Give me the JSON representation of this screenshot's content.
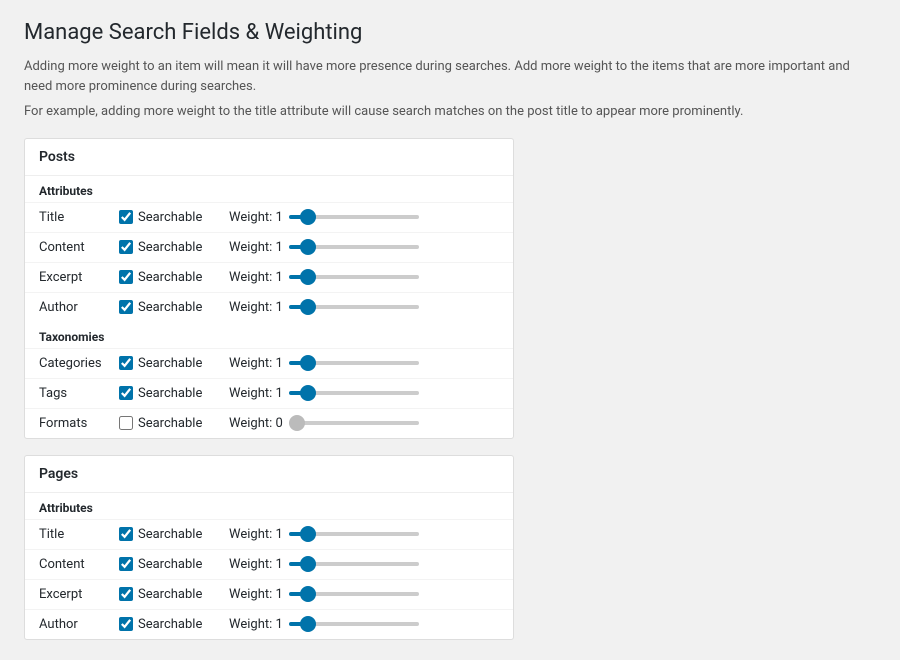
{
  "page": {
    "title": "Manage Search Fields & Weighting",
    "descriptions": [
      "Adding more weight to an item will mean it will have more presence during searches. Add more weight to the items that are more important and need more prominence during searches.",
      "For example, adding more weight to the title attribute will cause search matches on the post title to appear more prominently."
    ]
  },
  "sections": [
    {
      "id": "posts",
      "title": "Posts",
      "groups": [
        {
          "label": "Attributes",
          "fields": [
            {
              "name": "Title",
              "searchable": true,
              "weight": 1
            },
            {
              "name": "Content",
              "searchable": true,
              "weight": 1
            },
            {
              "name": "Excerpt",
              "searchable": true,
              "weight": 1
            },
            {
              "name": "Author",
              "searchable": true,
              "weight": 1
            }
          ]
        },
        {
          "label": "Taxonomies",
          "fields": [
            {
              "name": "Categories",
              "searchable": true,
              "weight": 1
            },
            {
              "name": "Tags",
              "searchable": true,
              "weight": 1
            },
            {
              "name": "Formats",
              "searchable": false,
              "weight": 0
            }
          ]
        }
      ]
    },
    {
      "id": "pages",
      "title": "Pages",
      "groups": [
        {
          "label": "Attributes",
          "fields": [
            {
              "name": "Title",
              "searchable": true,
              "weight": 1
            },
            {
              "name": "Content",
              "searchable": true,
              "weight": 1
            },
            {
              "name": "Excerpt",
              "searchable": true,
              "weight": 1
            },
            {
              "name": "Author",
              "searchable": true,
              "weight": 1
            }
          ]
        }
      ]
    }
  ],
  "labels": {
    "searchable": "Searchable",
    "weight_prefix": "Weight: "
  }
}
